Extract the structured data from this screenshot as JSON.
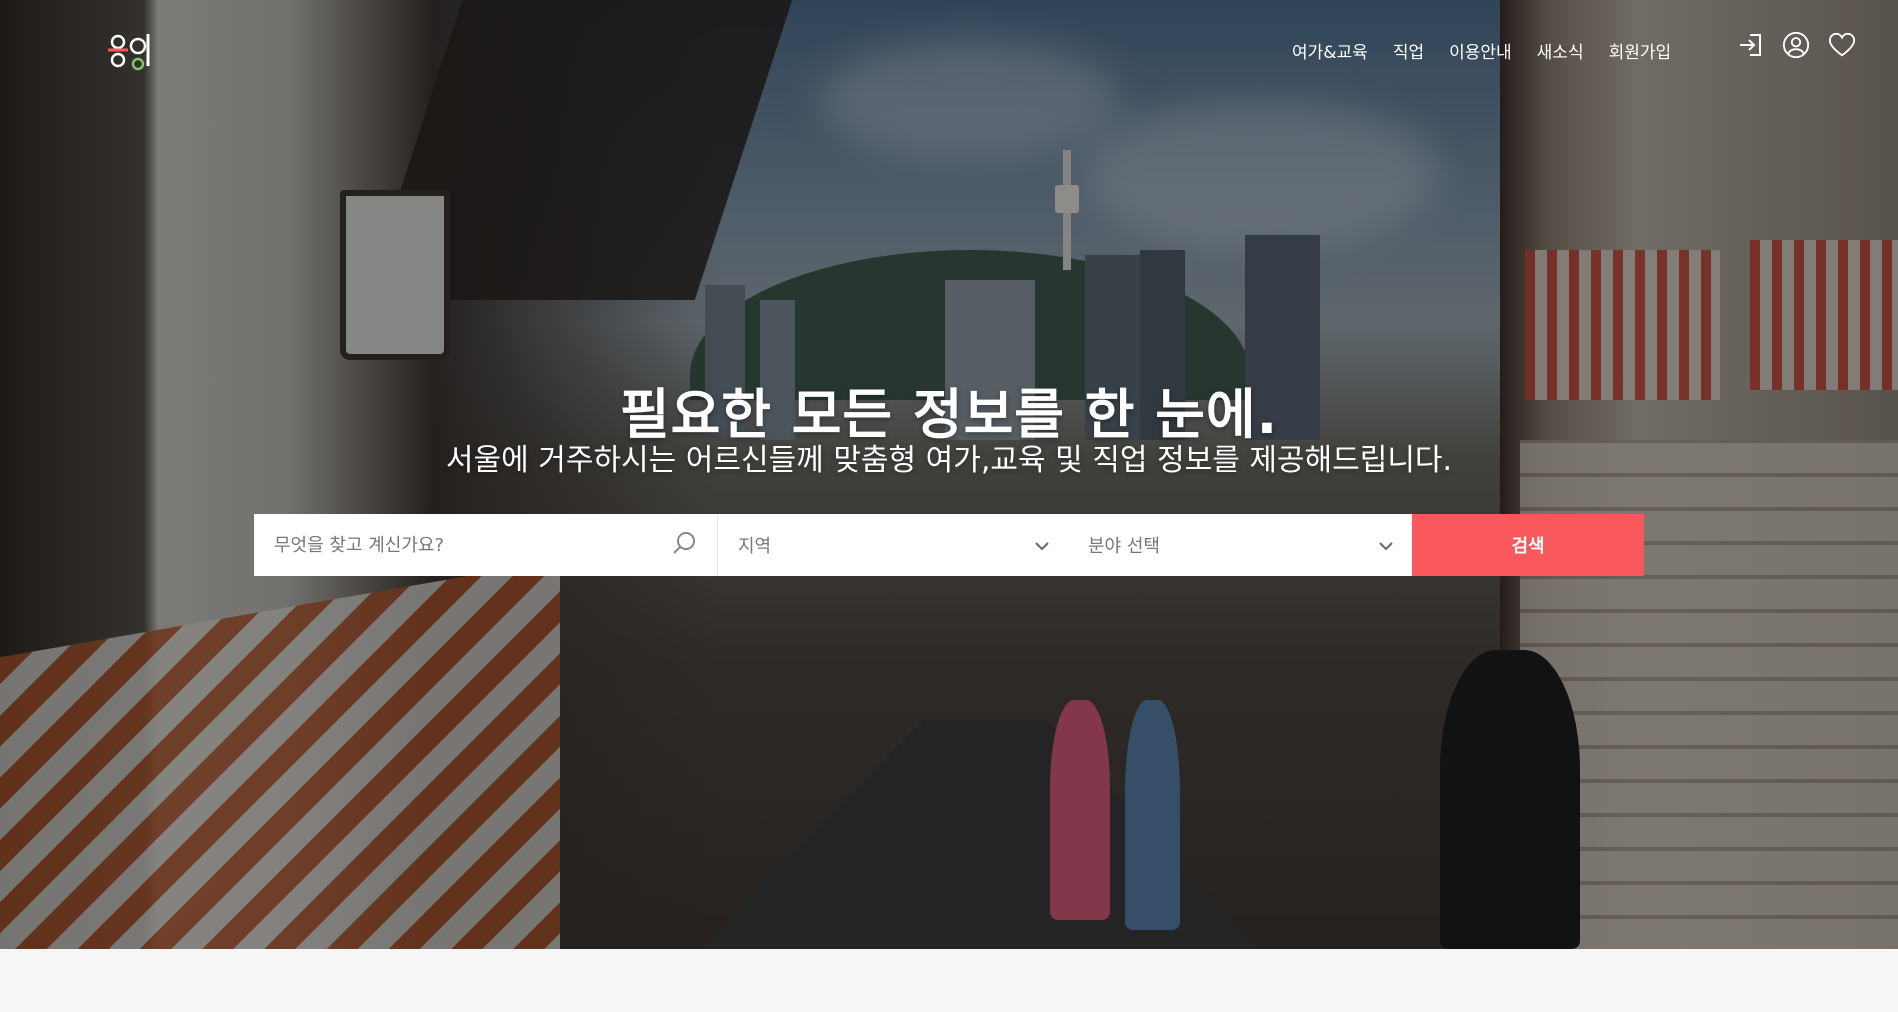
{
  "header": {
    "logo_alt": "동행",
    "nav": [
      {
        "label": "여가&교육"
      },
      {
        "label": "직업"
      },
      {
        "label": "이용안내"
      },
      {
        "label": "새소식"
      },
      {
        "label": "회원가입"
      }
    ],
    "icons": [
      "login-icon",
      "user-icon",
      "heart-icon"
    ]
  },
  "hero": {
    "title": "필요한 모든 정보를 한 눈에.",
    "subtitle": "서울에 거주하시는 어르신들께 맞춤형 여가,교육 및 직업 정보를 제공해드립니다."
  },
  "search": {
    "placeholder": "무엇을 찾고 계신가요?",
    "region_label": "지역",
    "field_label": "분야 선택",
    "button_label": "검색"
  },
  "colors": {
    "accent": "#f8585b",
    "text_light": "#ffffff"
  }
}
